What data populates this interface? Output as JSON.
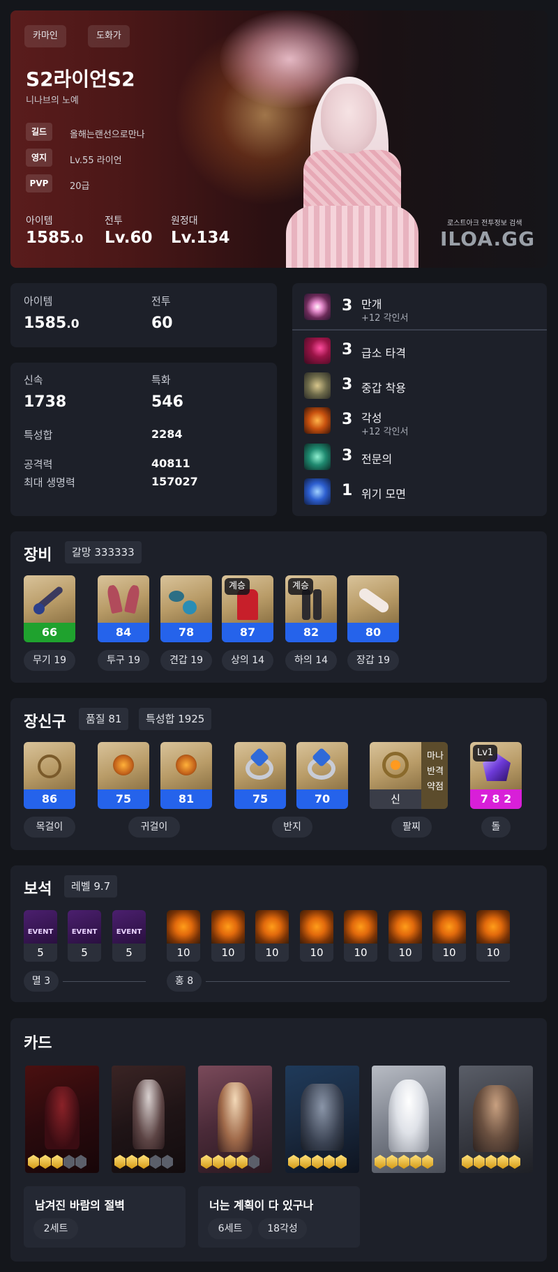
{
  "hero": {
    "tags": [
      "카마인",
      "도화가"
    ],
    "name": "S2라이언S2",
    "title": "니나브의 노예",
    "info": [
      {
        "label": "길드",
        "value": "올해는랜선으로만나"
      },
      {
        "label": "영지",
        "value": "Lv.55 라이언"
      },
      {
        "label": "PVP",
        "value": "20급"
      }
    ],
    "stats": [
      {
        "label": "아이템",
        "value": "1585",
        "decimal": ".0"
      },
      {
        "label": "전투",
        "value": "Lv.60"
      },
      {
        "label": "원정대",
        "value": "Lv.134"
      }
    ],
    "brand_sub": "로스트아크 전투정보 검색",
    "brand": "ILOA.GG"
  },
  "summary": {
    "item_label": "아이템",
    "item_value": "1585",
    "item_decimal": ".0",
    "combat_label": "전투",
    "combat_value": "60"
  },
  "stats": {
    "swift_label": "신속",
    "swift_value": "1738",
    "spec_label": "특화",
    "spec_value": "546",
    "sum_label": "특성합",
    "sum_value": "2284",
    "atk_label": "공격력",
    "atk_value": "40811",
    "hp_label": "최대 생명력",
    "hp_value": "157027"
  },
  "engravings": [
    {
      "level": "3",
      "name": "만개",
      "sub": "+12 각인서",
      "icon": "bloom-icon"
    },
    {
      "level": "3",
      "name": "급소 타격",
      "sub": "",
      "icon": "vital-strike-icon"
    },
    {
      "level": "3",
      "name": "중갑 착용",
      "sub": "",
      "icon": "heavy-armor-icon"
    },
    {
      "level": "3",
      "name": "각성",
      "sub": "+12 각인서",
      "icon": "awakening-icon"
    },
    {
      "level": "3",
      "name": "전문의",
      "sub": "",
      "icon": "specialist-icon"
    },
    {
      "level": "1",
      "name": "위기 모면",
      "sub": "",
      "icon": "crisis-evasion-icon"
    }
  ],
  "equipment": {
    "title": "장비",
    "badge": "갈망 333333",
    "items": [
      {
        "quality": "66",
        "label": "무기 19",
        "tag": "",
        "icon": "weapon-brush-icon",
        "bar": "green"
      },
      {
        "quality": "84",
        "label": "투구 19",
        "tag": "",
        "icon": "helmet-icon",
        "bar": "blue"
      },
      {
        "quality": "78",
        "label": "견갑 19",
        "tag": "",
        "icon": "shoulder-icon",
        "bar": "blue"
      },
      {
        "quality": "87",
        "label": "상의 14",
        "tag": "계승",
        "icon": "top-armor-icon",
        "bar": "blue"
      },
      {
        "quality": "82",
        "label": "하의 14",
        "tag": "계승",
        "icon": "bottom-armor-icon",
        "bar": "blue"
      },
      {
        "quality": "80",
        "label": "장갑 19",
        "tag": "",
        "icon": "glove-icon",
        "bar": "blue"
      }
    ]
  },
  "accessories": {
    "title": "장신구",
    "badge1": "품질 81",
    "badge2": "특성합 1925",
    "items": [
      {
        "quality": "86",
        "icon": "necklace-icon"
      },
      {
        "quality": "75",
        "icon": "earring-icon"
      },
      {
        "quality": "81",
        "icon": "earring-icon"
      },
      {
        "quality": "75",
        "icon": "ring-icon"
      },
      {
        "quality": "70",
        "icon": "ring-icon"
      }
    ],
    "bracelet": {
      "tier": "신",
      "effects": [
        "마나",
        "반격",
        "약점"
      ],
      "icon": "bracelet-icon"
    },
    "stone": {
      "level": "Lv1",
      "value": "7 8 2",
      "icon": "ability-stone-icon"
    },
    "labels": [
      "목걸이",
      "귀걸이",
      "반지",
      "팔찌",
      "돌"
    ]
  },
  "gems": {
    "title": "보석",
    "badge": "레벨 9.7",
    "event_text": "EVENT",
    "small": [
      "5",
      "5",
      "5"
    ],
    "large": [
      "10",
      "10",
      "10",
      "10",
      "10",
      "10",
      "10",
      "10"
    ],
    "group1": "멸 3",
    "group2": "홍 8"
  },
  "cards": {
    "title": "카드",
    "items": [
      {
        "stars": 3,
        "name": "dark-red-knight-card"
      },
      {
        "stars": 3,
        "name": "pale-swordsman-card"
      },
      {
        "stars": 4,
        "name": "blonde-noble-card"
      },
      {
        "stars": 5,
        "name": "armored-warrior-card"
      },
      {
        "stars": 5,
        "name": "white-sage-card"
      },
      {
        "stars": 5,
        "name": "bearded-dwarf-card"
      }
    ],
    "sets": [
      {
        "name": "남겨진 바람의 절벽",
        "tags": [
          "2세트"
        ]
      },
      {
        "name": "너는 계획이 다 있구나",
        "tags": [
          "6세트",
          "18각성"
        ]
      }
    ]
  }
}
